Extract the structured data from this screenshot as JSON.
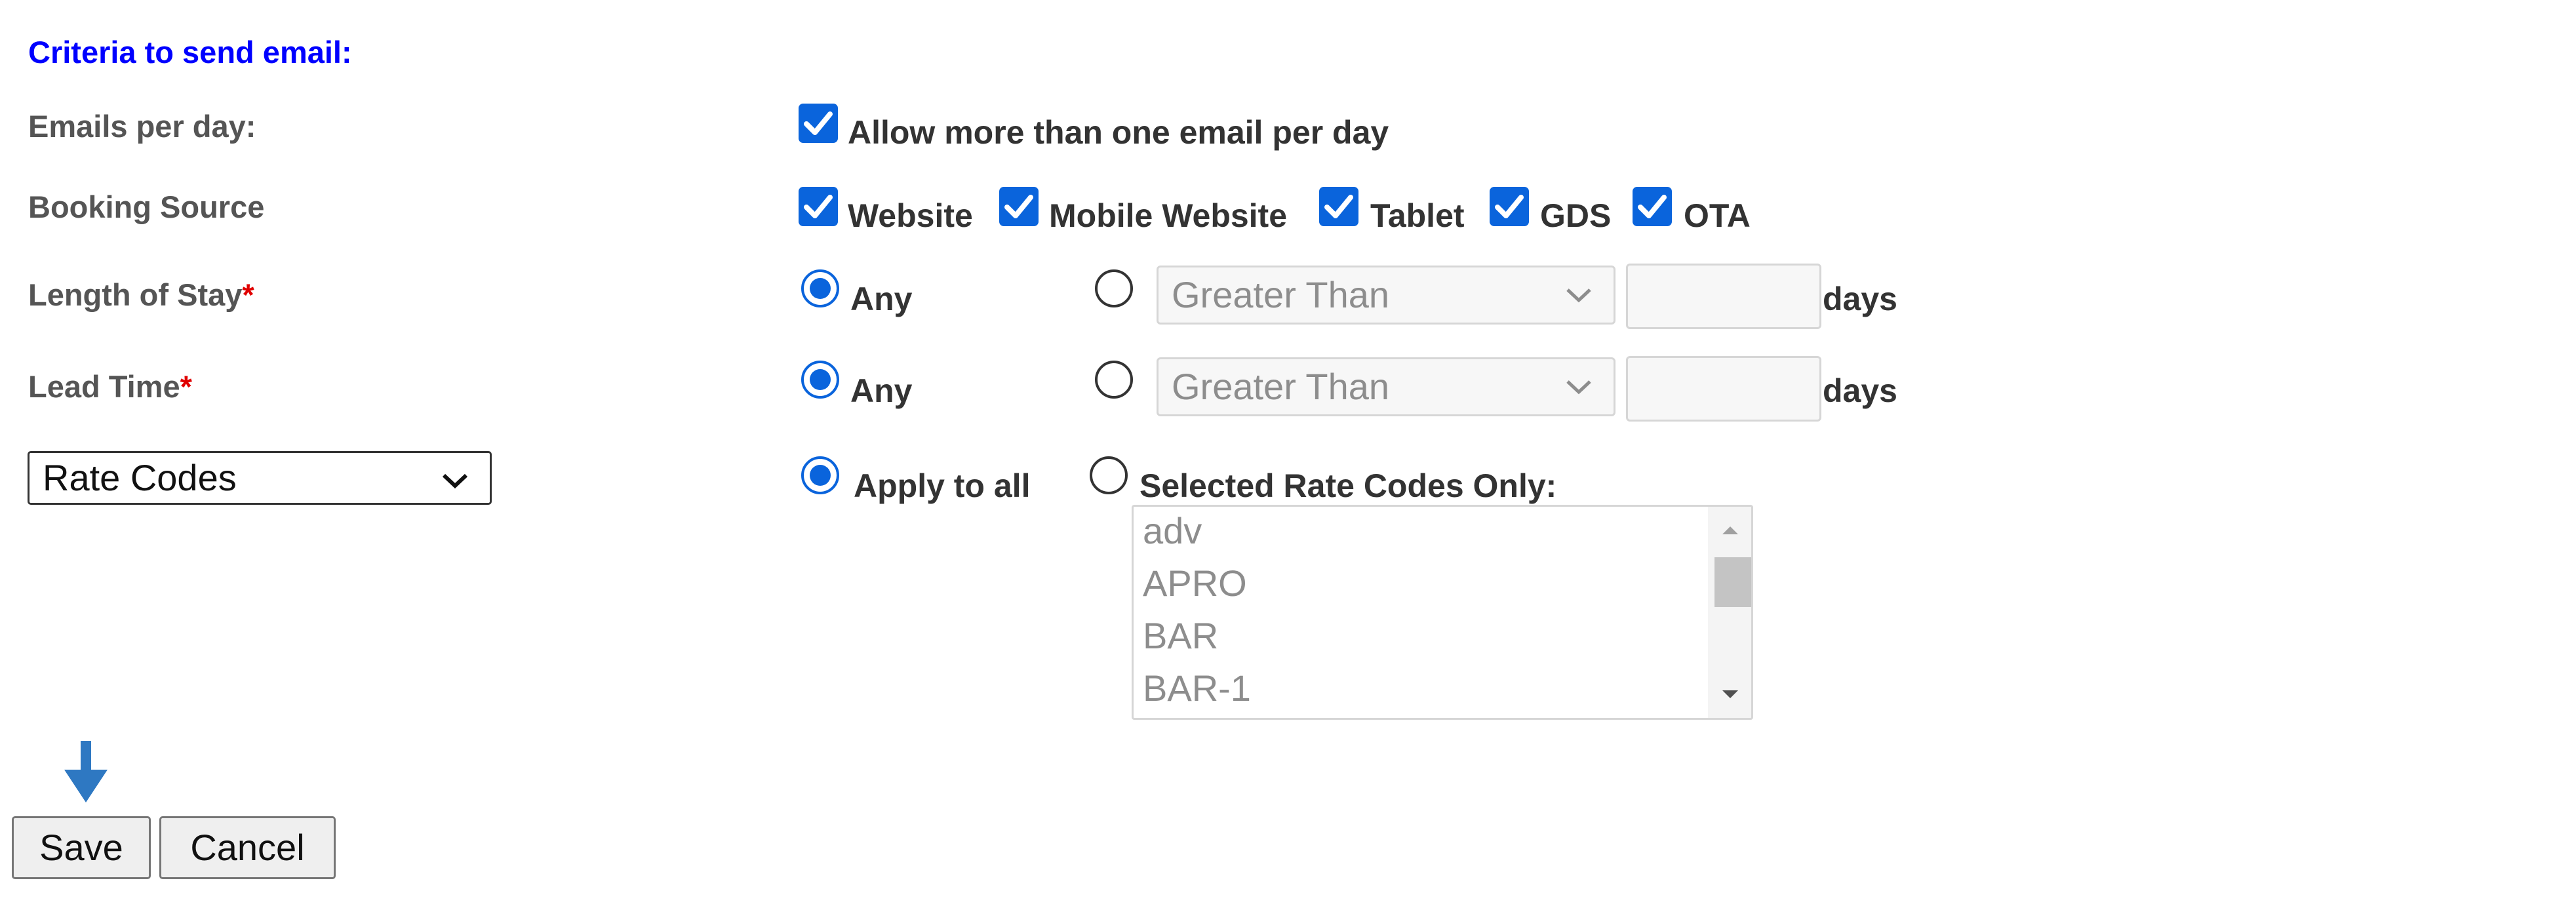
{
  "section_title": "Criteria to send email:",
  "emails_per_day": {
    "label": "Emails per day:",
    "checkbox_label": "Allow more than one email per day",
    "checked": true
  },
  "booking_source": {
    "label": "Booking Source",
    "options": [
      {
        "label": "Website",
        "checked": true
      },
      {
        "label": "Mobile Website",
        "checked": true
      },
      {
        "label": "Tablet",
        "checked": true
      },
      {
        "label": "GDS",
        "checked": true
      },
      {
        "label": "OTA",
        "checked": true
      }
    ]
  },
  "length_of_stay": {
    "label": "Length of Stay",
    "required_mark": "*",
    "any_label": "Any",
    "comparison": "Greater Than",
    "value": "",
    "unit": "days"
  },
  "lead_time": {
    "label": "Lead Time",
    "required_mark": "*",
    "any_label": "Any",
    "comparison": "Greater Than",
    "value": "",
    "unit": "days"
  },
  "rate_codes": {
    "selector_value": "Rate Codes",
    "apply_all_label": "Apply to all",
    "selected_only_label": "Selected Rate Codes Only:",
    "list": [
      "adv",
      "APRO",
      "BAR",
      "BAR-1"
    ]
  },
  "buttons": {
    "save": "Save",
    "cancel": "Cancel"
  },
  "colors": {
    "accent": "#0a64dc",
    "title": "#0000ff",
    "required": "#e00000",
    "arrow": "#2e78c2"
  },
  "icons": {
    "arrow": "arrow-down-icon",
    "chevron": "chevron-down-icon"
  }
}
